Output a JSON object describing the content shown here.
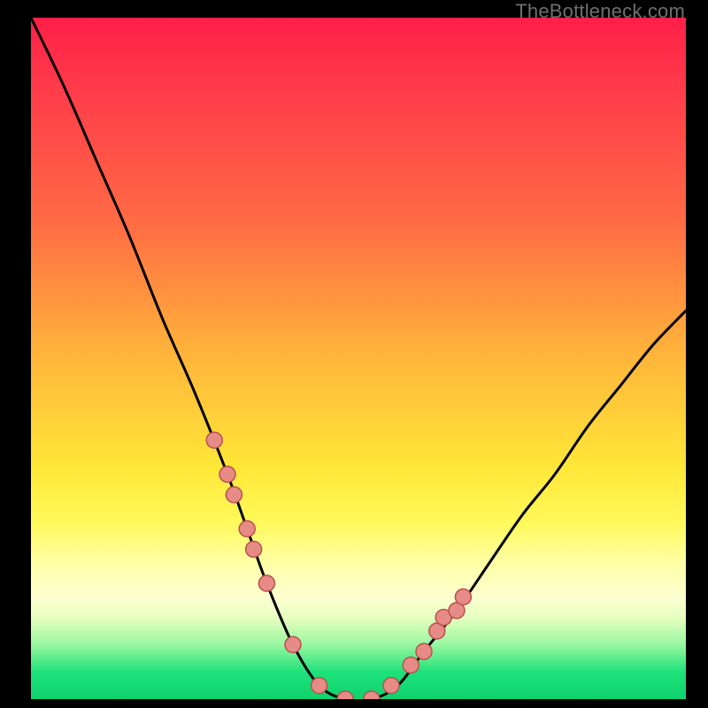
{
  "watermark": "TheBottleneck.com",
  "colors": {
    "bg": "#000000",
    "curve": "#000000",
    "dot_fill": "#e68b86",
    "dot_stroke": "#ba514e",
    "gradient_stops": [
      "#ff1f47",
      "#ff6b44",
      "#ffe738",
      "#fdffd0",
      "#1ee27a"
    ]
  },
  "chart_data": {
    "type": "line",
    "title": "",
    "xlabel": "",
    "ylabel": "",
    "xlim": [
      0,
      100
    ],
    "ylim": [
      0,
      100
    ],
    "x": [
      0,
      5,
      10,
      15,
      20,
      25,
      30,
      33,
      36,
      40,
      44,
      48,
      52,
      56,
      60,
      65,
      70,
      75,
      80,
      85,
      90,
      95,
      100
    ],
    "values": [
      100,
      90,
      79,
      68,
      56,
      45,
      33,
      25,
      17,
      8,
      2,
      0,
      0,
      2,
      7,
      13,
      20,
      27,
      33,
      40,
      46,
      52,
      57
    ],
    "annotations_x": [
      28,
      30,
      31,
      33,
      34,
      36,
      40,
      44,
      48,
      52,
      55,
      58,
      60,
      62,
      63,
      65,
      66
    ],
    "annotations_y": [
      38,
      33,
      30,
      25,
      22,
      17,
      8,
      2,
      0,
      0,
      2,
      5,
      7,
      10,
      12,
      13,
      15
    ],
    "grid": false
  }
}
